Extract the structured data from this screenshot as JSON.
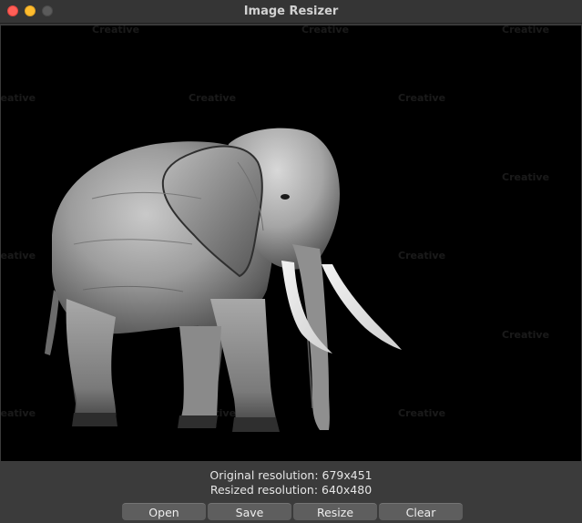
{
  "window": {
    "title": "Image Resizer",
    "controls": [
      "close",
      "minimize",
      "zoom"
    ]
  },
  "image": {
    "subject": "elephant-photo",
    "watermark_text": "Creative"
  },
  "info": {
    "original": "Original resolution: 679x451",
    "resized": "Resized resolution: 640x480"
  },
  "buttons": {
    "open": "Open",
    "save": "Save",
    "resize": "Resize",
    "clear": "Clear"
  },
  "colors": {
    "close": "#ff5f57",
    "minimize": "#febc2e",
    "zoom": "#5b5b5b",
    "canvas": "#000000",
    "button": "#5e5e5e"
  }
}
